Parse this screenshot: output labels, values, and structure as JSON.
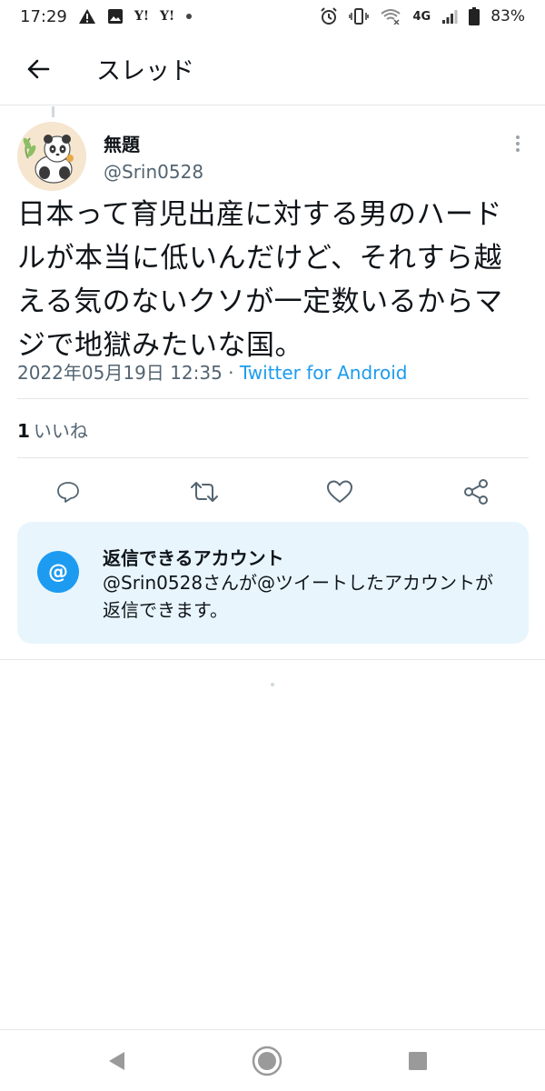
{
  "status_bar": {
    "time": "17:29",
    "network": "4G",
    "battery": "83%",
    "icons": [
      "warning-icon",
      "image-icon",
      "yahoo-icon",
      "yahoo-icon",
      "dot-icon",
      "alarm-icon",
      "vibrate-icon",
      "wifi-icon",
      "signal-icon",
      "battery-icon"
    ],
    "yahoo_label": "Y!"
  },
  "header": {
    "title": "スレッド",
    "back_icon": "arrow-left-icon"
  },
  "tweet": {
    "author_name": "無題",
    "author_handle": "@Srin0528",
    "avatar_icon": "panda-avatar",
    "text": "日本って育児出産に対する男のハードルが本当に低いんだけど、それすら越える気のないクソが一定数いるからマジで地獄みたいな国。",
    "timestamp": "2022年05月19日 12:35",
    "meta_separator": " · ",
    "source": "Twitter for Android",
    "likes_count": "1",
    "likes_label": "いいね"
  },
  "actions": [
    {
      "name": "reply-button",
      "icon": "reply-icon"
    },
    {
      "name": "retweet-button",
      "icon": "retweet-icon"
    },
    {
      "name": "like-button",
      "icon": "heart-icon"
    },
    {
      "name": "share-button",
      "icon": "share-icon"
    }
  ],
  "reply_info": {
    "icon_symbol": "@",
    "title": "返信できるアカウント",
    "description": "@Srin0528さんが@ツイートしたアカウントが返信できます。"
  },
  "colors": {
    "accent": "#1d9bf0",
    "card_background": "#e8f5fd",
    "text_primary": "#0f1419",
    "text_secondary": "#536471"
  }
}
